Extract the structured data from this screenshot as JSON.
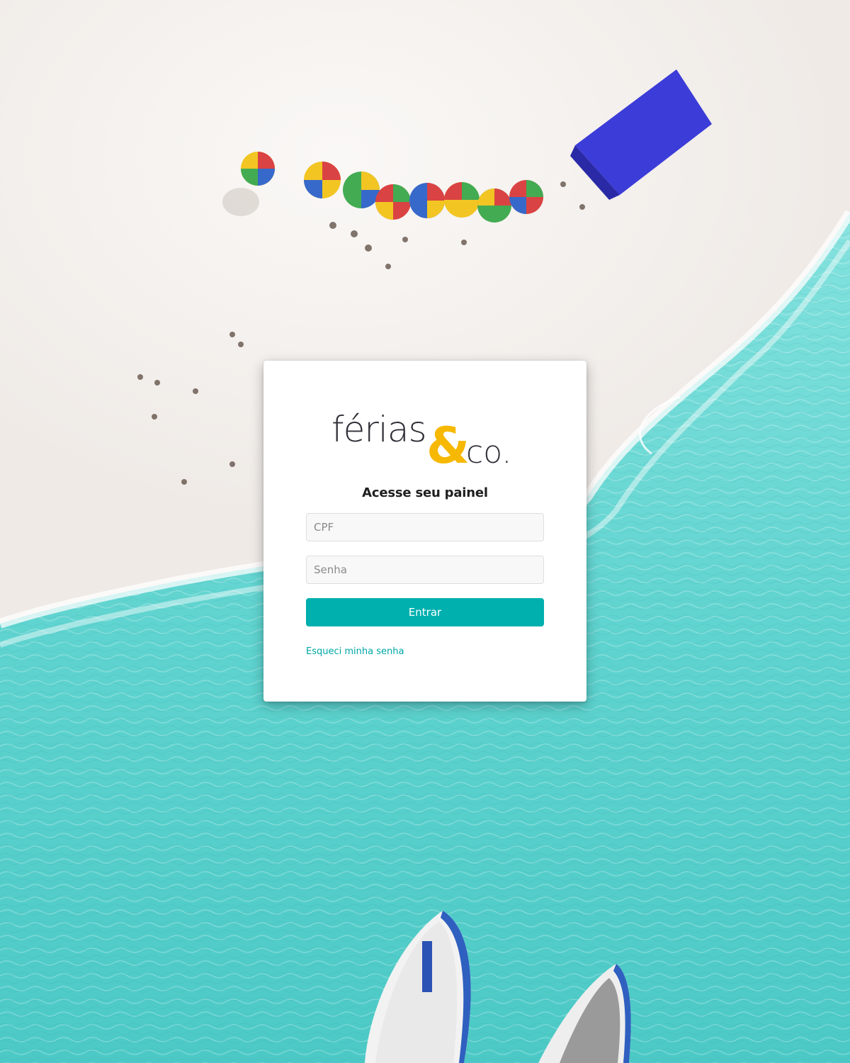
{
  "brand": {
    "logo_text_main": "férias",
    "logo_text_amp": "&",
    "logo_text_tail": "co.",
    "text_color": "#2f2f38",
    "accent_color": "#f6b800"
  },
  "login": {
    "heading": "Acesse seu painel",
    "cpf_placeholder": "CPF",
    "cpf_value": "",
    "senha_placeholder": "Senha",
    "senha_value": "",
    "submit_label": "Entrar",
    "forgot_label": "Esqueci minha senha",
    "button_color": "#00b0ae",
    "link_color": "#00a8a6"
  },
  "background": {
    "description_icon": "beach-aerial-image",
    "sand_color": "#f4f1ee",
    "water_color": "#5fd6d2"
  }
}
